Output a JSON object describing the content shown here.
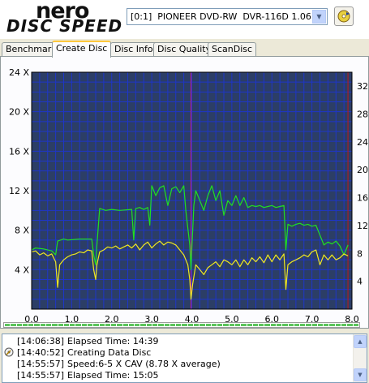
{
  "app": {
    "logo_line1": "nero",
    "logo_line2": "DISC SPEED"
  },
  "drive": {
    "selected": "[0:1]  PIONEER DVD-RW  DVR-116D 1.06"
  },
  "tabs": [
    {
      "label": "Benchmark"
    },
    {
      "label": "Create Disc"
    },
    {
      "label": "Disc Info"
    },
    {
      "label": "Disc Quality"
    },
    {
      "label": "ScanDisc"
    }
  ],
  "active_tab": "Create Disc",
  "chart_data": {
    "type": "line",
    "x_ticks": [
      "0.0",
      "1.0",
      "2.0",
      "3.0",
      "4.0",
      "5.0",
      "6.0",
      "7.0",
      "8.0"
    ],
    "y_ticks_left": [
      "4 X",
      "8 X",
      "12 X",
      "16 X",
      "20 X",
      "24 X"
    ],
    "y_ticks_right": [
      "4",
      "8",
      "12",
      "16",
      "20",
      "24",
      "28",
      "32"
    ],
    "xlim": [
      0,
      8
    ],
    "ylim_left": [
      0,
      24
    ],
    "ylim_right": [
      0,
      34
    ],
    "grid": true,
    "markers": [
      {
        "x": 3.98,
        "color": "#d0208c"
      },
      {
        "x": 7.9,
        "color": "#c01818"
      }
    ],
    "series": [
      {
        "color": "#20e020",
        "x": [
          0.0,
          0.1,
          0.3,
          0.5,
          0.6,
          0.65,
          0.8,
          0.9,
          1.2,
          1.5,
          1.55,
          1.6,
          1.63,
          1.7,
          1.85,
          2.0,
          2.2,
          2.5,
          2.55,
          2.6,
          2.7,
          2.8,
          2.9,
          2.95,
          3.0,
          3.1,
          3.2,
          3.3,
          3.4,
          3.5,
          3.6,
          3.7,
          3.8,
          3.85,
          3.95,
          3.98,
          4.0,
          4.05,
          4.1,
          4.2,
          4.3,
          4.4,
          4.5,
          4.6,
          4.7,
          4.8,
          4.9,
          5.0,
          5.1,
          5.2,
          5.3,
          5.4,
          5.5,
          5.6,
          5.7,
          5.8,
          5.9,
          6.0,
          6.1,
          6.2,
          6.3,
          6.35,
          6.4,
          6.5,
          6.6,
          6.7,
          6.8,
          6.9,
          7.0,
          7.1,
          7.2,
          7.3,
          7.4,
          7.5,
          7.6,
          7.7,
          7.8,
          7.9
        ],
        "y": [
          6,
          6.2,
          6.1,
          5.9,
          5.5,
          6.9,
          7.1,
          7.0,
          7.1,
          7.1,
          5.5,
          4.5,
          6.5,
          10.2,
          10.0,
          10.1,
          10.0,
          10.1,
          7.0,
          10.2,
          10.3,
          10.1,
          10.3,
          8.5,
          12.5,
          11.5,
          12.3,
          12.5,
          10.5,
          12.2,
          12.4,
          11.8,
          12.5,
          10.0,
          6.5,
          4.0,
          6.0,
          10.5,
          12.0,
          11.0,
          10.0,
          11.5,
          12.5,
          11.0,
          12.0,
          9.5,
          11.0,
          10.5,
          11.5,
          10.5,
          11.3,
          10.3,
          10.5,
          10.4,
          10.5,
          10.3,
          10.4,
          10.5,
          10.3,
          10.4,
          10.5,
          6.0,
          8.6,
          8.4,
          8.6,
          8.7,
          8.5,
          8.6,
          8.4,
          8.5,
          7.5,
          6.5,
          6.8,
          6.6,
          6.9,
          6.4,
          5.5,
          6.5
        ]
      },
      {
        "color": "#f0e820",
        "x": [
          0.0,
          0.1,
          0.2,
          0.3,
          0.4,
          0.5,
          0.6,
          0.65,
          0.7,
          0.8,
          0.9,
          1.0,
          1.1,
          1.2,
          1.3,
          1.4,
          1.5,
          1.55,
          1.6,
          1.63,
          1.7,
          1.8,
          1.9,
          2.0,
          2.1,
          2.2,
          2.3,
          2.4,
          2.5,
          2.6,
          2.7,
          2.8,
          2.9,
          3.0,
          3.1,
          3.2,
          3.3,
          3.4,
          3.5,
          3.6,
          3.7,
          3.8,
          3.9,
          3.95,
          3.98,
          4.02,
          4.1,
          4.2,
          4.3,
          4.4,
          4.5,
          4.6,
          4.7,
          4.8,
          4.9,
          5.0,
          5.1,
          5.2,
          5.3,
          5.4,
          5.5,
          5.6,
          5.7,
          5.8,
          5.9,
          6.0,
          6.1,
          6.2,
          6.3,
          6.35,
          6.4,
          6.5,
          6.6,
          6.7,
          6.8,
          6.9,
          7.0,
          7.1,
          7.2,
          7.3,
          7.4,
          7.5,
          7.6,
          7.7,
          7.8,
          7.9
        ],
        "y": [
          5.8,
          5.9,
          5.5,
          5.7,
          5.4,
          5.6,
          4.8,
          2.2,
          4.5,
          5.0,
          5.3,
          5.5,
          5.6,
          5.8,
          5.7,
          6.0,
          5.9,
          4.0,
          3.0,
          4.5,
          5.8,
          6.0,
          6.3,
          6.2,
          6.4,
          6.1,
          6.3,
          6.5,
          6.2,
          6.6,
          6.0,
          6.5,
          6.8,
          6.2,
          6.6,
          6.9,
          6.5,
          6.8,
          6.7,
          6.5,
          6.0,
          5.5,
          4.5,
          3.0,
          1.0,
          2.5,
          4.5,
          4.0,
          3.5,
          4.2,
          4.5,
          4.8,
          4.3,
          5.0,
          4.8,
          4.5,
          5.0,
          4.3,
          5.0,
          4.5,
          5.2,
          4.8,
          5.3,
          4.7,
          5.5,
          4.8,
          5.5,
          5.0,
          5.6,
          2.0,
          4.5,
          4.8,
          5.0,
          5.2,
          5.5,
          5.3,
          5.8,
          6.0,
          4.5,
          5.5,
          5.0,
          5.5,
          5.0,
          5.2,
          5.6,
          5.4
        ]
      }
    ]
  },
  "progress": {
    "fraction": 1.0,
    "segments": 60
  },
  "log": [
    {
      "time": "[14:06:38]",
      "message": "Elapsed Time: 14:39",
      "icon": ""
    },
    {
      "time": "[14:40:52]",
      "message": "Creating Data Disc",
      "icon": "disc-write-icon"
    },
    {
      "time": "[14:55:57]",
      "message": "Speed:6-5 X CAV (8.78 X average)",
      "icon": ""
    },
    {
      "time": "[14:55:57]",
      "message": "Elapsed Time: 15:05",
      "icon": ""
    }
  ]
}
